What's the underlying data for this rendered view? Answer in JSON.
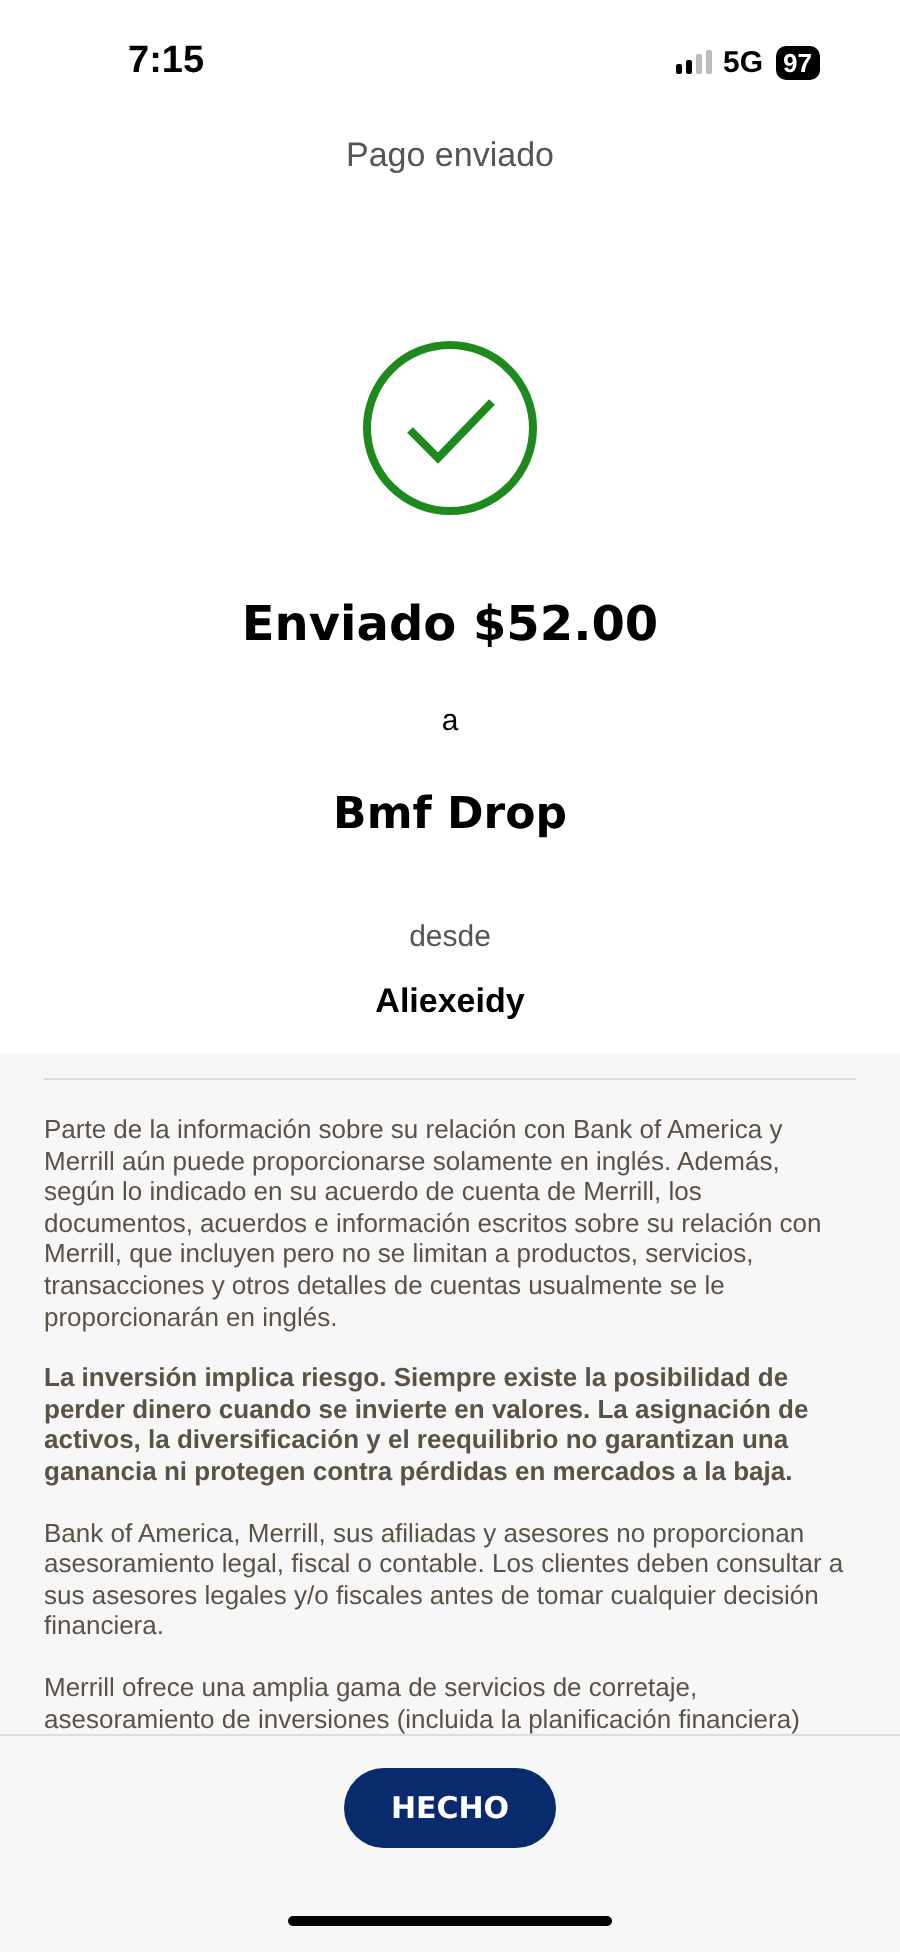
{
  "status_bar": {
    "time": "7:15",
    "network": "5G",
    "battery": "97"
  },
  "header": {
    "title": "Pago enviado"
  },
  "confirmation": {
    "amount_line": "Enviado $52.00",
    "connector": "a",
    "recipient": "Bmf Drop",
    "from_label": "desde",
    "sender": "Aliexeidy"
  },
  "disclosures": [
    {
      "text": "Parte de la información sobre su relación con Bank of America y Merrill aún puede proporcionarse solamente en inglés. Además, según lo indicado en su acuerdo de cuenta de Merrill, los documentos, acuerdos e información escritos sobre su relación con Merrill, que incluyen pero no se limitan a productos, servicios, transacciones y otros detalles de cuentas usualmente se le proporcionarán en inglés.",
      "bold": false
    },
    {
      "text": "La inversión implica riesgo. Siempre existe la posibilidad de perder dinero cuando se invierte en valores. La asignación de activos, la diversificación y el reequilibrio no garantizan una ganancia ni protegen contra pérdidas en mercados a la baja.",
      "bold": true
    },
    {
      "text": "Bank of America, Merrill, sus afiliadas y asesores no proporcionan asesoramiento legal, fiscal o contable. Los clientes deben consultar a sus asesores legales y/o fiscales antes de tomar cualquier decisión financiera.",
      "bold": false
    },
    {
      "text": "Merrill ofrece una amplia gama de servicios de corretaje, asesoramiento de inversiones (incluida la planificación financiera)",
      "bold": false
    }
  ],
  "footer": {
    "button": "HECHO"
  }
}
